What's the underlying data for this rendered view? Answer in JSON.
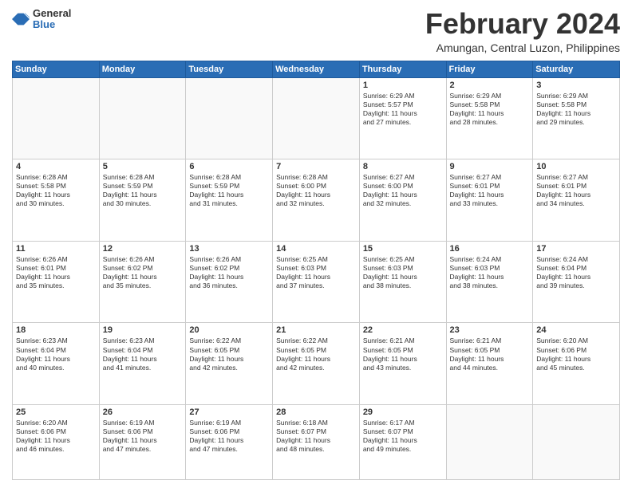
{
  "header": {
    "logo_general": "General",
    "logo_blue": "Blue",
    "month_title": "February 2024",
    "location": "Amungan, Central Luzon, Philippines"
  },
  "days_of_week": [
    "Sunday",
    "Monday",
    "Tuesday",
    "Wednesday",
    "Thursday",
    "Friday",
    "Saturday"
  ],
  "weeks": [
    [
      {
        "day": "",
        "content": ""
      },
      {
        "day": "",
        "content": ""
      },
      {
        "day": "",
        "content": ""
      },
      {
        "day": "",
        "content": ""
      },
      {
        "day": "1",
        "content": "Sunrise: 6:29 AM\nSunset: 5:57 PM\nDaylight: 11 hours\nand 27 minutes."
      },
      {
        "day": "2",
        "content": "Sunrise: 6:29 AM\nSunset: 5:58 PM\nDaylight: 11 hours\nand 28 minutes."
      },
      {
        "day": "3",
        "content": "Sunrise: 6:29 AM\nSunset: 5:58 PM\nDaylight: 11 hours\nand 29 minutes."
      }
    ],
    [
      {
        "day": "4",
        "content": "Sunrise: 6:28 AM\nSunset: 5:58 PM\nDaylight: 11 hours\nand 30 minutes."
      },
      {
        "day": "5",
        "content": "Sunrise: 6:28 AM\nSunset: 5:59 PM\nDaylight: 11 hours\nand 30 minutes."
      },
      {
        "day": "6",
        "content": "Sunrise: 6:28 AM\nSunset: 5:59 PM\nDaylight: 11 hours\nand 31 minutes."
      },
      {
        "day": "7",
        "content": "Sunrise: 6:28 AM\nSunset: 6:00 PM\nDaylight: 11 hours\nand 32 minutes."
      },
      {
        "day": "8",
        "content": "Sunrise: 6:27 AM\nSunset: 6:00 PM\nDaylight: 11 hours\nand 32 minutes."
      },
      {
        "day": "9",
        "content": "Sunrise: 6:27 AM\nSunset: 6:01 PM\nDaylight: 11 hours\nand 33 minutes."
      },
      {
        "day": "10",
        "content": "Sunrise: 6:27 AM\nSunset: 6:01 PM\nDaylight: 11 hours\nand 34 minutes."
      }
    ],
    [
      {
        "day": "11",
        "content": "Sunrise: 6:26 AM\nSunset: 6:01 PM\nDaylight: 11 hours\nand 35 minutes."
      },
      {
        "day": "12",
        "content": "Sunrise: 6:26 AM\nSunset: 6:02 PM\nDaylight: 11 hours\nand 35 minutes."
      },
      {
        "day": "13",
        "content": "Sunrise: 6:26 AM\nSunset: 6:02 PM\nDaylight: 11 hours\nand 36 minutes."
      },
      {
        "day": "14",
        "content": "Sunrise: 6:25 AM\nSunset: 6:03 PM\nDaylight: 11 hours\nand 37 minutes."
      },
      {
        "day": "15",
        "content": "Sunrise: 6:25 AM\nSunset: 6:03 PM\nDaylight: 11 hours\nand 38 minutes."
      },
      {
        "day": "16",
        "content": "Sunrise: 6:24 AM\nSunset: 6:03 PM\nDaylight: 11 hours\nand 38 minutes."
      },
      {
        "day": "17",
        "content": "Sunrise: 6:24 AM\nSunset: 6:04 PM\nDaylight: 11 hours\nand 39 minutes."
      }
    ],
    [
      {
        "day": "18",
        "content": "Sunrise: 6:23 AM\nSunset: 6:04 PM\nDaylight: 11 hours\nand 40 minutes."
      },
      {
        "day": "19",
        "content": "Sunrise: 6:23 AM\nSunset: 6:04 PM\nDaylight: 11 hours\nand 41 minutes."
      },
      {
        "day": "20",
        "content": "Sunrise: 6:22 AM\nSunset: 6:05 PM\nDaylight: 11 hours\nand 42 minutes."
      },
      {
        "day": "21",
        "content": "Sunrise: 6:22 AM\nSunset: 6:05 PM\nDaylight: 11 hours\nand 42 minutes."
      },
      {
        "day": "22",
        "content": "Sunrise: 6:21 AM\nSunset: 6:05 PM\nDaylight: 11 hours\nand 43 minutes."
      },
      {
        "day": "23",
        "content": "Sunrise: 6:21 AM\nSunset: 6:05 PM\nDaylight: 11 hours\nand 44 minutes."
      },
      {
        "day": "24",
        "content": "Sunrise: 6:20 AM\nSunset: 6:06 PM\nDaylight: 11 hours\nand 45 minutes."
      }
    ],
    [
      {
        "day": "25",
        "content": "Sunrise: 6:20 AM\nSunset: 6:06 PM\nDaylight: 11 hours\nand 46 minutes."
      },
      {
        "day": "26",
        "content": "Sunrise: 6:19 AM\nSunset: 6:06 PM\nDaylight: 11 hours\nand 47 minutes."
      },
      {
        "day": "27",
        "content": "Sunrise: 6:19 AM\nSunset: 6:06 PM\nDaylight: 11 hours\nand 47 minutes."
      },
      {
        "day": "28",
        "content": "Sunrise: 6:18 AM\nSunset: 6:07 PM\nDaylight: 11 hours\nand 48 minutes."
      },
      {
        "day": "29",
        "content": "Sunrise: 6:17 AM\nSunset: 6:07 PM\nDaylight: 11 hours\nand 49 minutes."
      },
      {
        "day": "",
        "content": ""
      },
      {
        "day": "",
        "content": ""
      }
    ]
  ]
}
